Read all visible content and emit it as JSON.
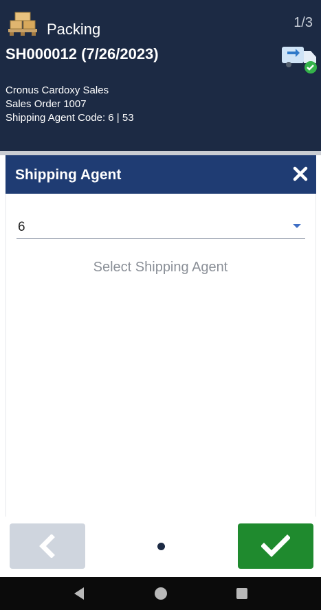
{
  "header": {
    "app_icon": "pallet-boxes-icon",
    "app_title": "Packing",
    "page_counter": "1/3",
    "doc_title": "SH000012 (7/26/2023)",
    "status_icon": "truck-check-icon",
    "details": [
      "Cronus Cardoxy Sales",
      "Sales Order 1007",
      "Shipping Agent Code: 6 | 53"
    ]
  },
  "dialog": {
    "title": "Shipping Agent",
    "close_icon": "close-icon",
    "select_value": "6",
    "hint": "Select Shipping Agent"
  },
  "footer": {
    "back_icon": "chevron-left-icon",
    "confirm_icon": "checkmark-icon",
    "page_indicator": {
      "current": 1,
      "total": 1
    }
  },
  "colors": {
    "header_bg": "#1c2a44",
    "dialog_header_bg": "#1f3c73",
    "confirm_green": "#1f8a2e",
    "back_disabled": "#cfd5de"
  }
}
